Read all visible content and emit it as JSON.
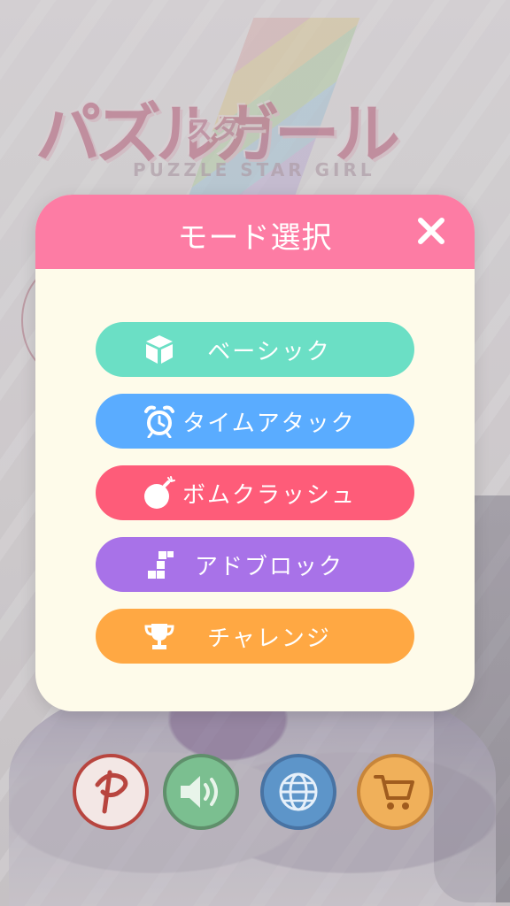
{
  "background": {
    "logo_text": "パズルガール",
    "logo_sub": "スター",
    "tagline": "PUZZLE STAR GIRL"
  },
  "modal": {
    "title": "モード選択",
    "close_icon": "close-icon",
    "header_color": "#fd7ca4",
    "body_color": "#fefbea"
  },
  "modes": [
    {
      "label": "ベーシック",
      "icon": "cube-icon",
      "color": "#6bdfc5"
    },
    {
      "label": "タイムアタック",
      "icon": "alarm-clock-icon",
      "color": "#5aacff"
    },
    {
      "label": "ボムクラッシュ",
      "icon": "bomb-icon",
      "color": "#fe5c79"
    },
    {
      "label": "アドブロック",
      "icon": "tetromino-icon",
      "color": "#a872e8"
    },
    {
      "label": "チャレンジ",
      "icon": "trophy-icon",
      "color": "#ffa843"
    }
  ],
  "bottom_buttons": [
    {
      "name": "p-logo-button",
      "icon": "p-logo-icon"
    },
    {
      "name": "sound-button",
      "icon": "speaker-icon"
    },
    {
      "name": "language-button",
      "icon": "globe-icon"
    },
    {
      "name": "shop-button",
      "icon": "cart-icon"
    }
  ]
}
